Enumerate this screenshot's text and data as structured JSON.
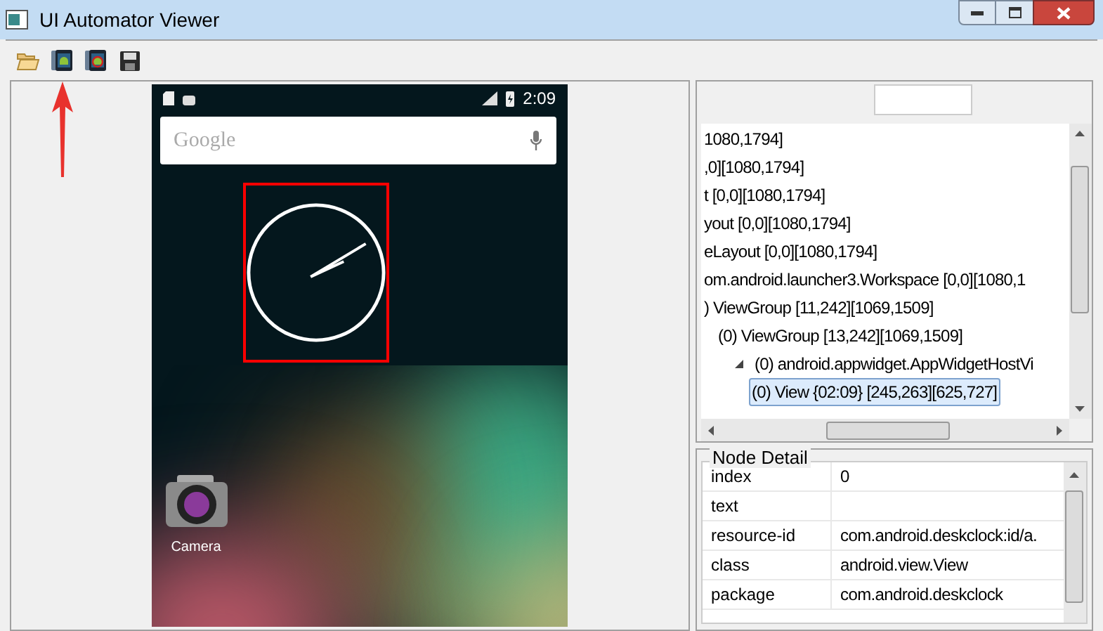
{
  "window": {
    "title": "UI Automator Viewer"
  },
  "toolbar": {
    "buttons": [
      {
        "kind": "open"
      },
      {
        "kind": "screenshot"
      },
      {
        "kind": "screenshot_compressed"
      },
      {
        "kind": "save"
      }
    ]
  },
  "device_screen": {
    "status_bar": {
      "time": "2:09"
    },
    "search_bar": {
      "placeholder": "Google"
    },
    "clock_widget": {
      "highlighted": true
    },
    "apps": [
      {
        "label": "Camera"
      }
    ]
  },
  "hierarchy": {
    "tree": [
      {
        "label": "1080,1794]",
        "children": [
          {
            "label": ",0][1080,1794]",
            "children": [
              {
                "label": "t [0,0][1080,1794]",
                "children": [
                  {
                    "label": "yout [0,0][1080,1794]",
                    "children": [
                      {
                        "label": "eLayout [0,0][1080,1794]",
                        "children": [
                          {
                            "label": "om.android.launcher3.Workspace [0,0][1080,1",
                            "children": [
                              {
                                "label": ") ViewGroup [11,242][1069,1509]",
                                "children": [
                                  {
                                    "label": "(0) ViewGroup [13,242][1069,1509]",
                                    "children": [
                                      {
                                        "label": "(0) android.appwidget.AppWidgetHostVi",
                                        "expanded": true,
                                        "children": [
                                          {
                                            "label": "(0) View {02:09} [245,263][625,727]",
                                            "selected": true
                                          }
                                        ]
                                      }
                                    ]
                                  }
                                ]
                              }
                            ]
                          }
                        ]
                      }
                    ]
                  }
                ]
              }
            ]
          }
        ]
      }
    ]
  },
  "node_detail": {
    "title": "Node Detail",
    "rows": [
      {
        "name": "index",
        "value": "0"
      },
      {
        "name": "text"
      },
      {
        "name": "resource-id",
        "value": "com.android.deskclock:id/a."
      },
      {
        "name": "class",
        "value": "android.view.View"
      },
      {
        "name": "package",
        "value": "com.android.deskclock"
      }
    ]
  }
}
